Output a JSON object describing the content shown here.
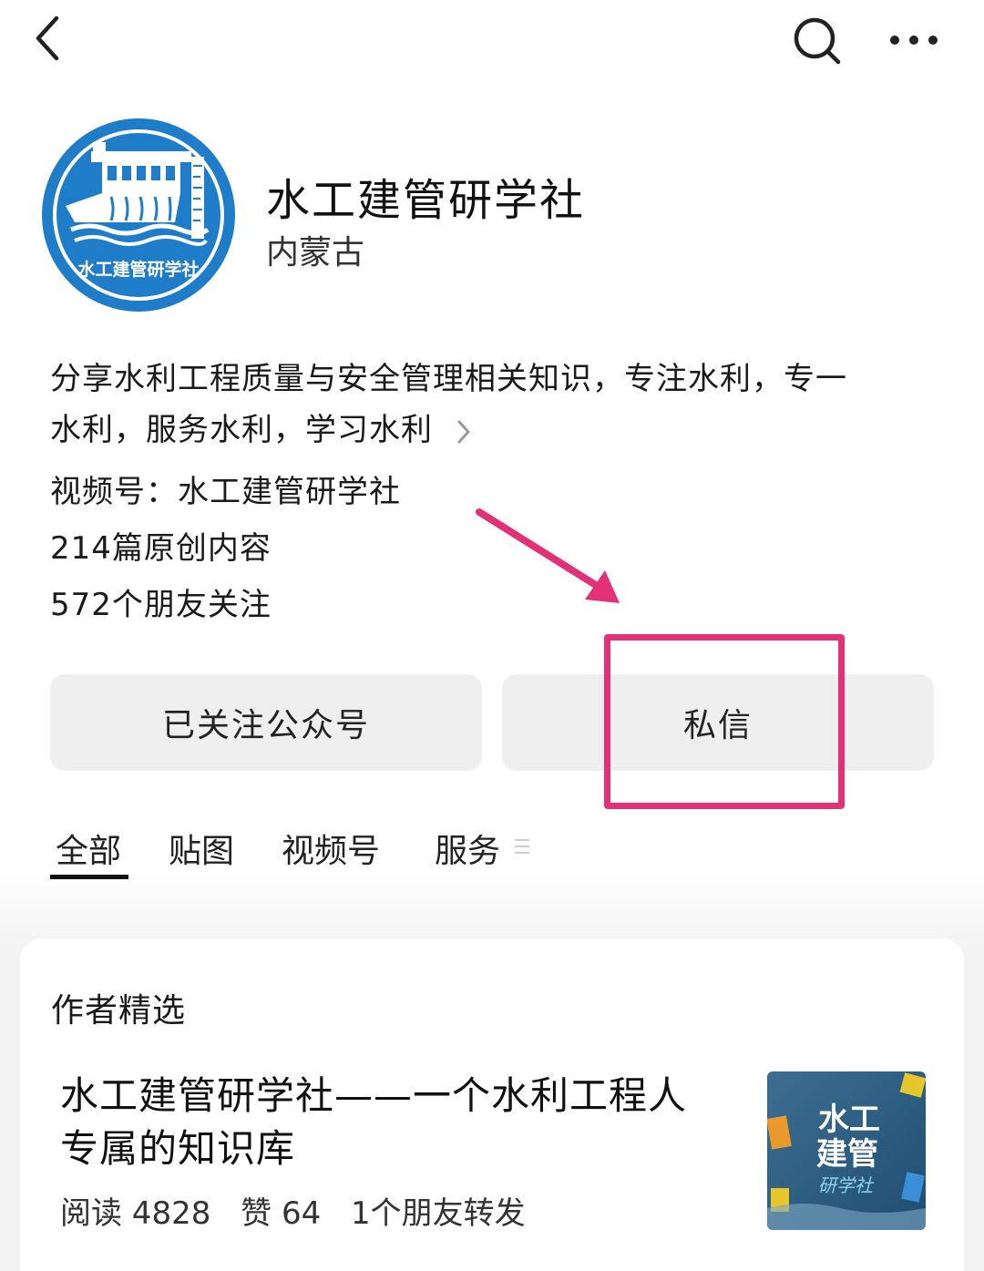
{
  "topbar": {
    "back_icon": "chevron-left-icon",
    "search_icon": "search-icon",
    "more_icon": "more-horizontal-icon"
  },
  "profile": {
    "name": "水工建管研学社",
    "region": "内蒙古",
    "logo_text": "水工建管研学社",
    "logo_color": "#1e7cc8",
    "description_line1": "分享水利工程质量与安全管理相关知识，专注水利，专一",
    "description_line2": "水利，服务水利，学习水利",
    "channel": "视频号：水工建管研学社",
    "original_count": "214篇原创内容",
    "friends_following": "572个朋友关注"
  },
  "actions": {
    "follow_label": "已关注公众号",
    "message_label": "私信"
  },
  "annotation": {
    "color": "#e33178"
  },
  "tabs": [
    {
      "label": "全部",
      "active": true
    },
    {
      "label": "贴图",
      "active": false
    },
    {
      "label": "视频号",
      "active": false
    },
    {
      "label": "服务",
      "active": false
    }
  ],
  "featured": {
    "section_title": "作者精选",
    "article": {
      "title_line1": "水工建管研学社——一个水利工程人",
      "title_line2": "专属的知识库",
      "reads": "阅读 4828",
      "likes": "赞 64",
      "shares": "1个朋友转发",
      "thumb_text_1": "水工",
      "thumb_text_2": "建管",
      "thumb_text_3": "研学社"
    }
  }
}
